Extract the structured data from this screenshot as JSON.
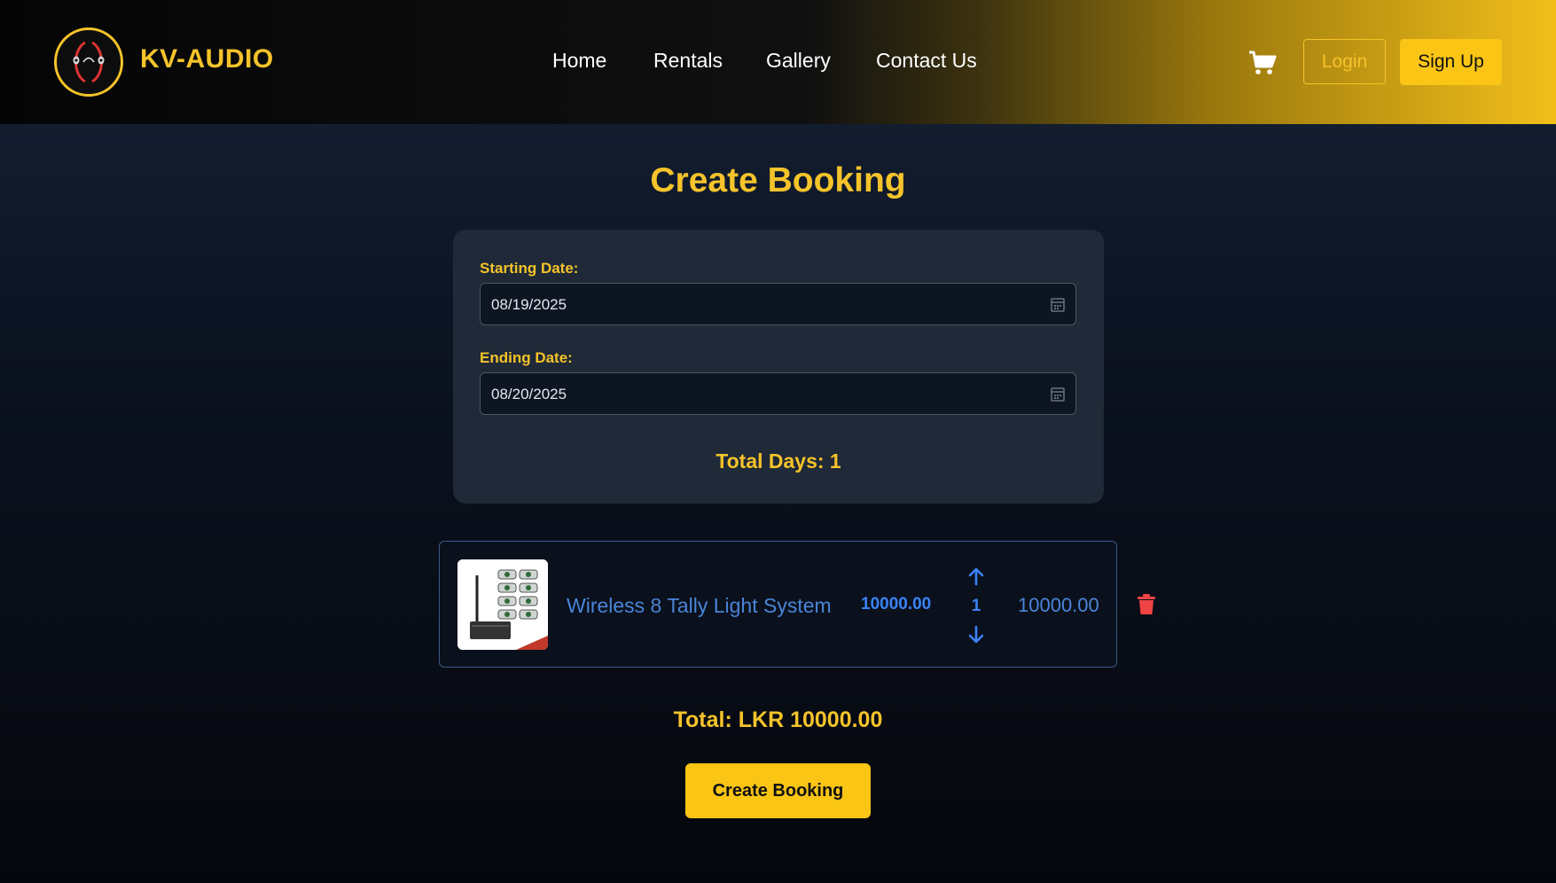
{
  "header": {
    "brand": "KV-AUDIO",
    "nav": [
      "Home",
      "Rentals",
      "Gallery",
      "Contact Us"
    ],
    "login_label": "Login",
    "signup_label": "Sign Up"
  },
  "page_title": "Create Booking",
  "booking": {
    "start_label": "Starting Date:",
    "start_value": "08/19/2025",
    "end_label": "Ending Date:",
    "end_value": "08/20/2025",
    "total_days": "Total Days: 1"
  },
  "cart_items": [
    {
      "name": "Wireless 8 Tally Light System",
      "price": "10000.00",
      "quantity": "1",
      "subtotal": "10000.00"
    }
  ],
  "total": "Total: LKR 10000.00",
  "create_button": "Create Booking",
  "colors": {
    "accent": "#fac515",
    "link_blue": "#3b82f6",
    "danger": "#ef4444",
    "card_bg": "#1f2937"
  }
}
